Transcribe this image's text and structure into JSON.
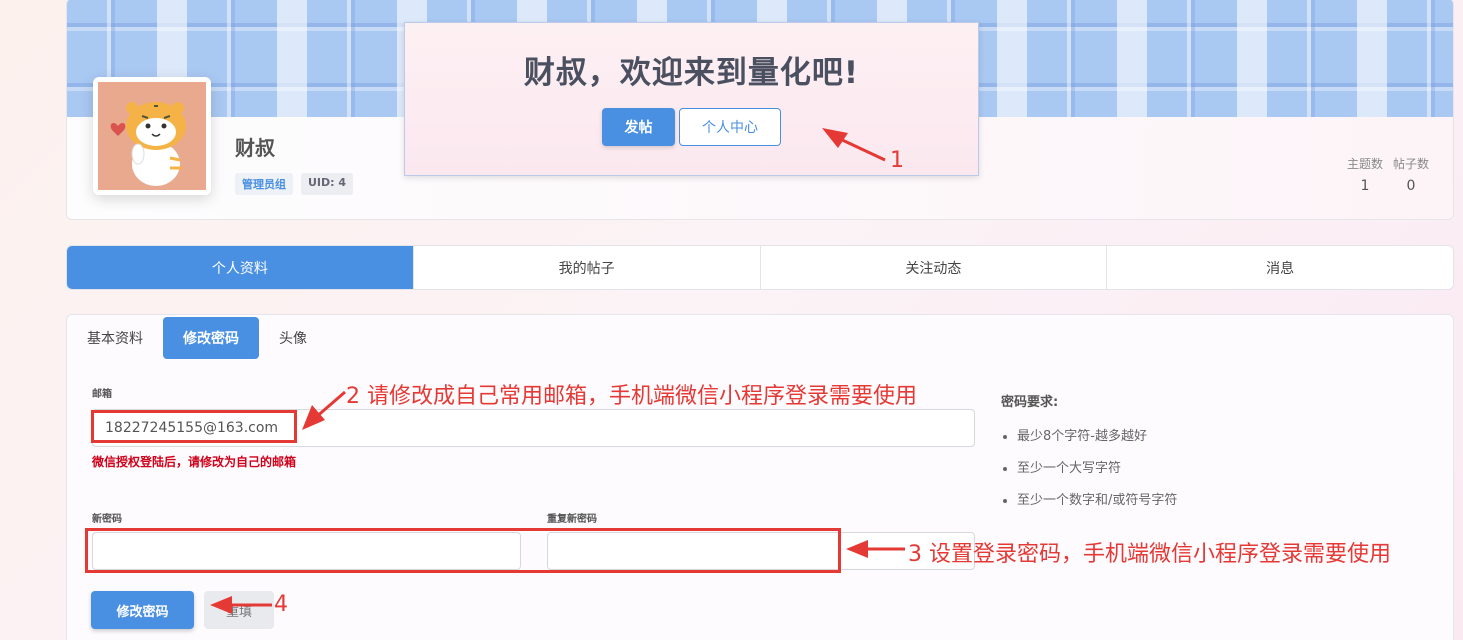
{
  "welcome": {
    "title": "财叔，欢迎来到量化吧!",
    "post_button": "发帖",
    "center_button": "个人中心"
  },
  "profile": {
    "username": "财叔",
    "badge_group": "管理员组",
    "badge_uid": "UID: 4",
    "stats": [
      {
        "label": "主题数",
        "value": "1"
      },
      {
        "label": "帖子数",
        "value": "0"
      }
    ]
  },
  "main_tabs": [
    "个人资料",
    "我的帖子",
    "关注动态",
    "消息"
  ],
  "sub_tabs": [
    "基本资料",
    "修改密码",
    "头像"
  ],
  "form": {
    "email_label": "邮箱",
    "email_value": "18227245155@163.com",
    "email_hint": "微信授权登陆后，请修改为自己的邮箱",
    "new_password_label": "新密码",
    "repeat_password_label": "重复新密码",
    "submit_button": "修改密码",
    "reset_button": "重填"
  },
  "requirements": {
    "title": "密码要求:",
    "items": [
      "最少8个字符-越多越好",
      "至少一个大写字符",
      "至少一个数字和/或符号字符"
    ]
  },
  "annotations": [
    {
      "number": "1",
      "text": ""
    },
    {
      "number": "2",
      "text": "请修改成自己常用邮箱，手机端微信小程序登录需要使用"
    },
    {
      "number": "3",
      "text": "设置登录密码，手机端微信小程序登录需要使用"
    },
    {
      "number": "4",
      "text": ""
    }
  ],
  "colors": {
    "accent": "#4a90e2",
    "annotation": "#e53935",
    "hint": "#d0021b"
  }
}
